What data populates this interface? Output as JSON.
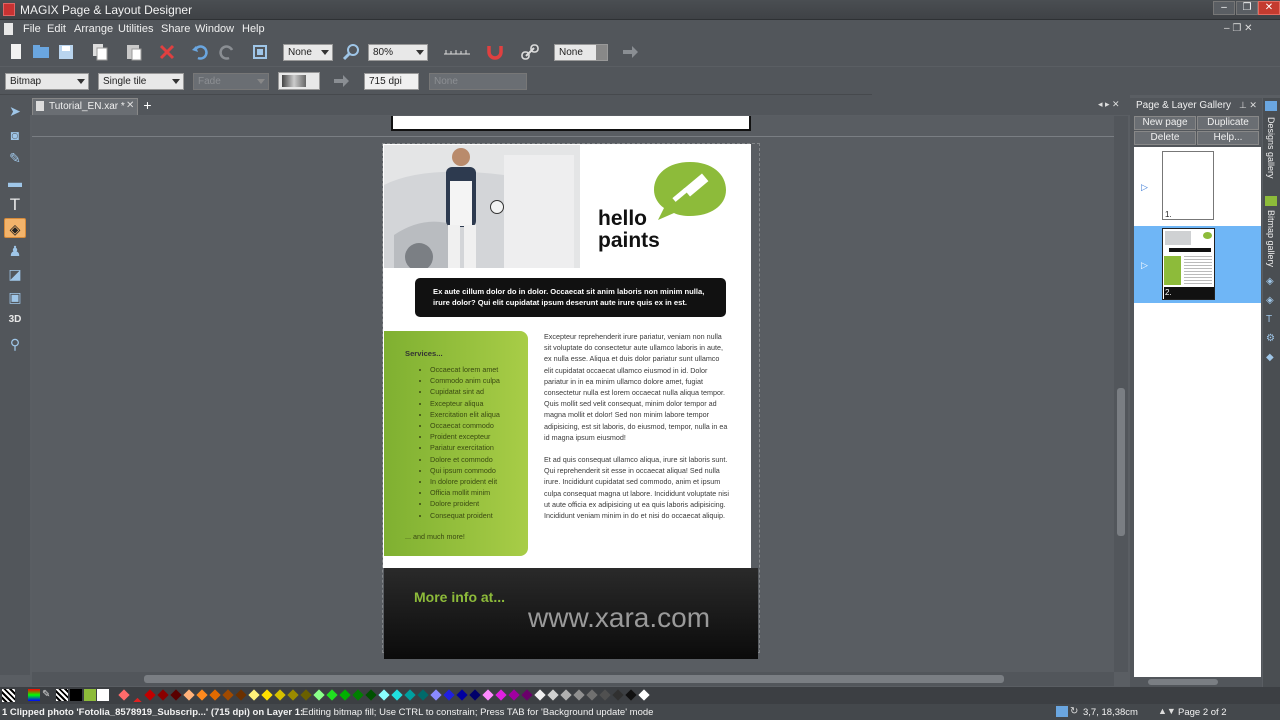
{
  "window": {
    "title": "MAGIX Page & Layout Designer"
  },
  "menu": [
    "File",
    "Edit",
    "Arrange",
    "Utilities",
    "Share",
    "Window",
    "Help"
  ],
  "toolbar": {
    "feather_value": "None",
    "zoom_value": "80%",
    "transparency_value": "None"
  },
  "fillbar": {
    "fill_type": "Bitmap",
    "tiling": "Single tile",
    "effect": "Fade",
    "dpi": "715 dpi",
    "none_field": "None"
  },
  "tab": {
    "label": "Tutorial_EN.xar *"
  },
  "gallery": {
    "title": "Page & Layer Gallery",
    "buttons": [
      "New page",
      "Duplicate",
      "Delete",
      "Help..."
    ],
    "pages": [
      "1.",
      "2."
    ]
  },
  "side_tabs": [
    "Designs gallery",
    "Bitmap gallery"
  ],
  "document": {
    "headline1": "hello",
    "headline2": "paints",
    "banner": "Ex aute cillum dolor do in dolor. Occaecat sit anim laboris non minim nulla, irure dolor? Qui elit cupidatat ipsum deserunt aute irure quis ex in est.",
    "services_title": "Services...",
    "services": [
      "Occaecat lorem amet",
      "Commodo anim culpa",
      "Cupidatat sint ad",
      "Excepteur aliqua",
      "Exercitation elit aliqua",
      "Occaecat commodo",
      "Proident excepteur",
      "Pariatur exercitation",
      "Dolore et commodo",
      "Qui ipsum commodo",
      "In dolore proident elit",
      "Officia mollit minim",
      "Dolore proident",
      "Consequat proident"
    ],
    "services_more": "... and much more!",
    "para1": "Excepteur reprehenderit irure pariatur, veniam non nulla sit voluptate do consectetur aute ullamco laboris in aute, ex nulla esse. Aliqua et duis dolor pariatur sunt ullamco elit cupidatat occaecat ullamco eiusmod in id. Dolor pariatur in in ea minim ullamco dolore amet, fugiat consectetur nulla est lorem occaecat nulla aliqua tempor. Quis mollit sed velit consequat, minim dolor tempor ad magna mollit et dolor! Sed non minim labore tempor adipisicing, est sit laboris, do eiusmod, tempor, nulla in ea id magna ipsum eiusmod!",
    "para2": "Et ad quis consequat ullamco aliqua, irure sit laboris sunt. Qui reprehenderit sit esse in occaecat aliqua! Sed nulla irure. Incididunt cupidatat sed commodo, anim et ipsum culpa consequat magna ut labore. Incididunt voluptate nisi ut aute officia ex adipisicing ut ea quis laboris adipisicing. Incididunt veniam minim in do et nisi do occaecat aliquip.",
    "more_info": "More info at...",
    "url": "www.xara.com"
  },
  "status": {
    "message": "1 Clipped photo 'Fotolia_8578919_Subscrip...' (715 dpi) on Layer 1:",
    "hint": "Editing bitmap fill; Use CTRL to constrain; Press TAB for 'Background update' mode",
    "coords": "3,7, 18,38cm",
    "page": "Page 2 of 2"
  },
  "colors": {
    "accent_green": "#8dbb3a",
    "page_bg": "#ffffff",
    "ui_bg": "#52565b"
  }
}
